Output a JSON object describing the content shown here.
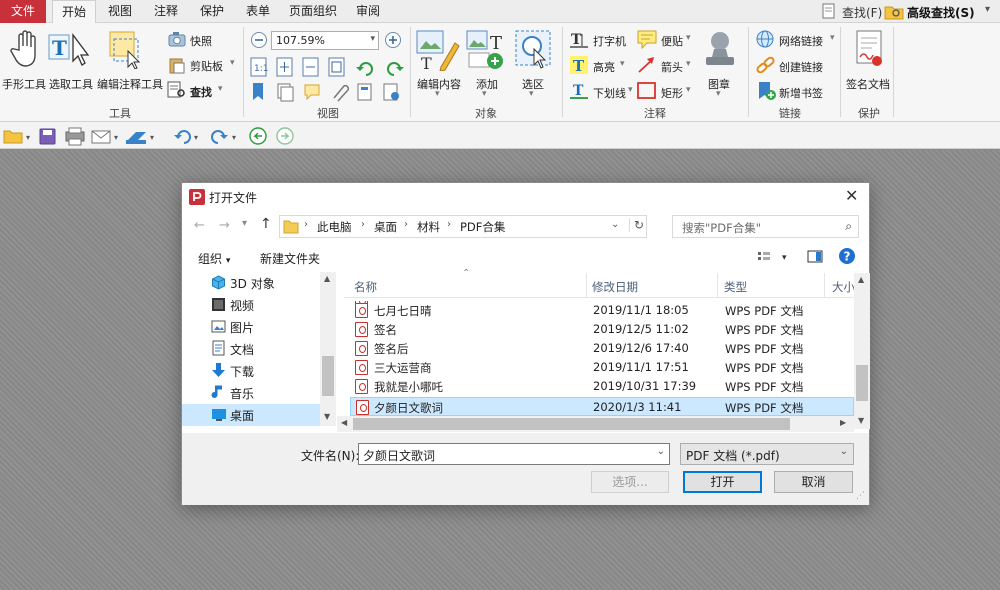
{
  "menu": {
    "tabs": [
      "文件",
      "开始",
      "视图",
      "注释",
      "保护",
      "表单",
      "页面组织",
      "审阅"
    ],
    "active": "开始",
    "find_label": "查找(F)",
    "advanced_find_label": "高级查找(S)"
  },
  "ribbon": {
    "tools": {
      "hand": "手形工具",
      "select": "选取工具",
      "edit_annot": "编辑注释工具",
      "snapshot": "快照",
      "clipboard": "剪贴板",
      "find": "查找",
      "group": "工具"
    },
    "view": {
      "zoom": "107.59%",
      "group": "视图"
    },
    "object": {
      "edit_content": "编辑内容",
      "add": "添加",
      "select_area": "选区",
      "group": "对象"
    },
    "annot": {
      "typewriter": "打字机",
      "note": "便贴",
      "highlight": "高亮",
      "arrow": "箭头",
      "underline": "下划线",
      "rect": "矩形",
      "stamp": "图章",
      "group": "注释"
    },
    "link": {
      "web_link": "网络链接",
      "create_link": "创建链接",
      "new_bookmark": "新增书签",
      "group": "链接"
    },
    "protect": {
      "sign": "签名文档",
      "group": "保护"
    }
  },
  "dialog": {
    "title": "打开文件",
    "path": [
      "此电脑",
      "桌面",
      "材料",
      "PDF合集"
    ],
    "search_placeholder": "搜索\"PDF合集\"",
    "organize": "组织",
    "new_folder": "新建文件夹",
    "nav": [
      {
        "label": "3D 对象",
        "icon": "3d-objects-icon"
      },
      {
        "label": "视频",
        "icon": "video-icon"
      },
      {
        "label": "图片",
        "icon": "pictures-icon"
      },
      {
        "label": "文档",
        "icon": "documents-icon"
      },
      {
        "label": "下载",
        "icon": "download-icon"
      },
      {
        "label": "音乐",
        "icon": "music-icon"
      },
      {
        "label": "桌面",
        "icon": "desktop-icon"
      }
    ],
    "columns": {
      "name": "名称",
      "date": "修改日期",
      "type": "类型",
      "size": "大小"
    },
    "files": [
      {
        "name": "七月七日晴",
        "date": "2019/11/1 18:05",
        "type": "WPS PDF 文档"
      },
      {
        "name": "签名",
        "date": "2019/12/5 11:02",
        "type": "WPS PDF 文档"
      },
      {
        "name": "签名后",
        "date": "2019/12/6 17:40",
        "type": "WPS PDF 文档"
      },
      {
        "name": "三大运营商",
        "date": "2019/11/1 17:51",
        "type": "WPS PDF 文档"
      },
      {
        "name": "我就是小哪吒",
        "date": "2019/10/31 17:39",
        "type": "WPS PDF 文档"
      },
      {
        "name": "夕颜日文歌词",
        "date": "2020/1/3 11:41",
        "type": "WPS PDF 文档"
      }
    ],
    "selected_index": 5,
    "filename_label": "文件名(N):",
    "filename_value": "夕颜日文歌词",
    "filetype": "PDF 文档 (*.pdf)",
    "options_button": "选项...",
    "open_button": "打开",
    "cancel_button": "取消"
  },
  "colors": {
    "accent": "#c8313a",
    "selection": "#cce8ff",
    "primary_button_border": "#0078d7"
  }
}
